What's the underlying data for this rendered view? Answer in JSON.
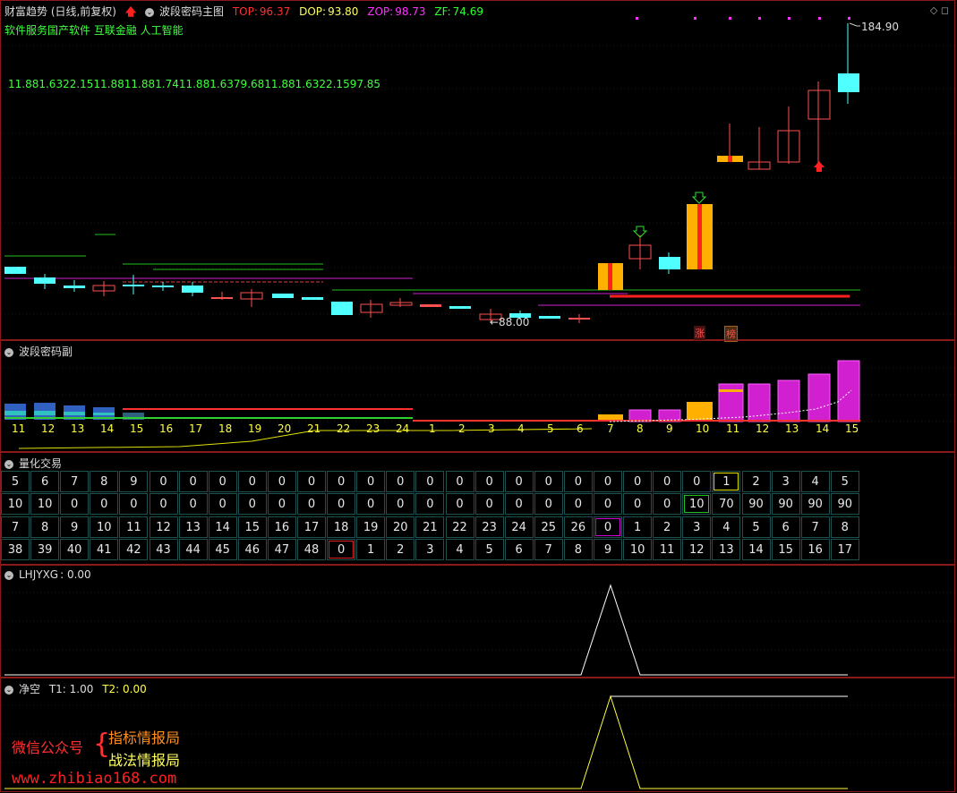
{
  "main_panel": {
    "title": "财富趋势 (日线,前复权)",
    "indicator_name": "波段密码主图",
    "top": {
      "label": "TOP:",
      "value": "96.37",
      "color": "#ff3030"
    },
    "dop": {
      "label": "DOP:",
      "value": "93.80",
      "color": "#ffff60"
    },
    "zop": {
      "label": "ZOP:",
      "value": "98.73",
      "color": "#ff30ff"
    },
    "zf": {
      "label": "ZF:",
      "value": "74.69",
      "color": "#30ff30"
    },
    "sectors": "软件服务国产软件 互联金融 人工智能",
    "numbers_line": "11.881.6322.1511.8811.881.7411.881.6379.6811.881.6322.1597.85",
    "high_label": "184.90",
    "low_label": "←88.00",
    "tag_zhang": "涨",
    "tag_bang": "榜"
  },
  "sub_panel": {
    "title": "波段密码副",
    "counts": [
      "11",
      "12",
      "13",
      "14",
      "15",
      "16",
      "17",
      "18",
      "19",
      "20",
      "21",
      "22",
      "23",
      "24",
      "1",
      "2",
      "3",
      "4",
      "5",
      "6",
      "7",
      "8",
      "9",
      "10",
      "11",
      "12",
      "13",
      "14",
      "15"
    ]
  },
  "quant_panel": {
    "title": "量化交易",
    "rows": [
      [
        "5",
        "6",
        "7",
        "8",
        "9",
        "0",
        "0",
        "0",
        "0",
        "0",
        "0",
        "0",
        "0",
        "0",
        "0",
        "0",
        "0",
        "0",
        "0",
        "0",
        "0",
        "0",
        "0",
        "0",
        "1",
        "2",
        "3",
        "4",
        "5"
      ],
      [
        "10",
        "10",
        "0",
        "0",
        "0",
        "0",
        "0",
        "0",
        "0",
        "0",
        "0",
        "0",
        "0",
        "0",
        "0",
        "0",
        "0",
        "0",
        "0",
        "0",
        "0",
        "0",
        "0",
        "10",
        "70",
        "90",
        "90",
        "90",
        "90"
      ],
      [
        "7",
        "8",
        "9",
        "10",
        "11",
        "12",
        "13",
        "14",
        "15",
        "16",
        "17",
        "18",
        "19",
        "20",
        "21",
        "22",
        "23",
        "24",
        "25",
        "26",
        "0",
        "1",
        "2",
        "3",
        "4",
        "5",
        "6",
        "7",
        "8"
      ],
      [
        "38",
        "39",
        "40",
        "41",
        "42",
        "43",
        "44",
        "45",
        "46",
        "47",
        "48",
        "0",
        "1",
        "2",
        "3",
        "4",
        "5",
        "6",
        "7",
        "8",
        "9",
        "10",
        "11",
        "12",
        "13",
        "14",
        "15",
        "16",
        "17"
      ]
    ]
  },
  "lhj_panel": {
    "label": "LHJYXG",
    "value": ": 0.00"
  },
  "jk_panel": {
    "label": "净空",
    "t1": "T1: 1.00",
    "t2": "T2: 0.00"
  },
  "watermark": {
    "wechat": "微信公众号",
    "line1": "指标情报局",
    "line2": "战法情报局",
    "url": "www.zhibiao168.com"
  }
}
